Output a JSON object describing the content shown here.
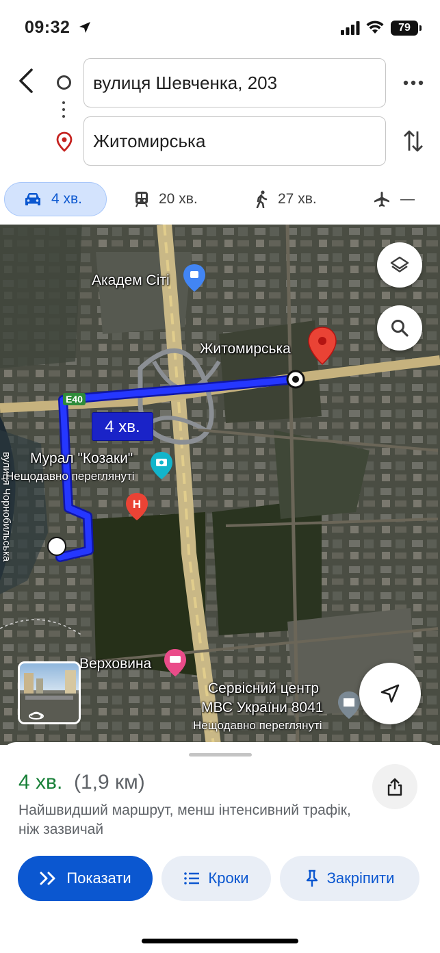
{
  "status_bar": {
    "time": "09:32",
    "battery": "79"
  },
  "route_inputs": {
    "origin": "вулиця Шевченка, 203",
    "destination": "Житомирська"
  },
  "modes": [
    {
      "icon": "car-icon",
      "label": "4 хв.",
      "active": true
    },
    {
      "icon": "train-icon",
      "label": "20 хв.",
      "active": false
    },
    {
      "icon": "walk-icon",
      "label": "27 хв.",
      "active": false
    },
    {
      "icon": "plane-icon",
      "label": "—",
      "active": false
    }
  ],
  "map": {
    "street_vertical": "вулиця Чорнобильська",
    "labels": {
      "akadem": "Академ Сіті",
      "zhytomyrska": "Житомирська",
      "mural": "Мурал \"Козаки\"",
      "mural_sub": "Нещодавно переглянуті",
      "verkhovyna": "Верховина",
      "service_center_1": "Сервісний центр",
      "service_center_2": "МВС України 8041",
      "service_sub": "Нещодавно переглянуті"
    },
    "route_badge": "4 хв.",
    "highway_shield": "E40",
    "route_color": "#1a2bff"
  },
  "sheet": {
    "eta": "4 хв.",
    "distance": "(1,9 км)",
    "description": "Найшвидший маршрут, менш інтенсивний трафік, ніж зазвичай",
    "buttons": {
      "show": "Показати",
      "steps": "Кроки",
      "pin": "Закріпити"
    }
  },
  "colors": {
    "accent": "#0b57d0",
    "eta_green": "#188038",
    "pin_red": "#ea4335"
  }
}
